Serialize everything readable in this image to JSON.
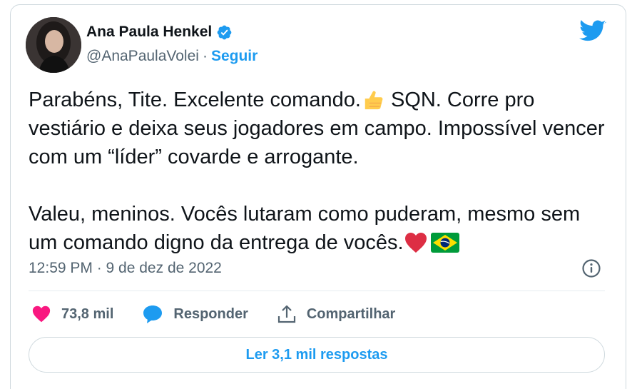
{
  "author": {
    "display_name": "Ana Paula Henkel",
    "handle": "@AnaPaulaVolei",
    "separator": "·",
    "follow_label": "Seguir",
    "avatar": "profile-photo"
  },
  "tweet": {
    "paragraph1_part1": "Parabéns, Tite. Excelente comando.",
    "paragraph1_emoji": "thumbs-up-emoji",
    "paragraph1_part2": " SQN. Corre pro vestiário e deixa seus jogadores em campo. Impossível vencer com um “líder” covarde e arrogante.",
    "paragraph2_text": "Valeu, meninos. Vocês lutaram como puderam, mesmo sem um comando digno da entrega de vocês.",
    "paragraph2_emojis": [
      "red-heart-emoji",
      "brazil-flag-emoji"
    ],
    "timestamp": "12:59 PM · 9 de dez de 2022"
  },
  "actions": {
    "likes_count": "73,8 mil",
    "reply_label": "Responder",
    "share_label": "Compartilhar"
  },
  "read_replies_label": "Ler 3,1 mil respostas",
  "colors": {
    "accent": "#1d9bf0",
    "like": "#f91880",
    "text": "#0f1419",
    "secondary": "#536471",
    "border": "#cfd9de"
  },
  "icons": [
    "twitter-bird-icon",
    "verified-badge-icon",
    "info-icon",
    "heart-icon",
    "reply-bubble-icon",
    "share-icon"
  ]
}
